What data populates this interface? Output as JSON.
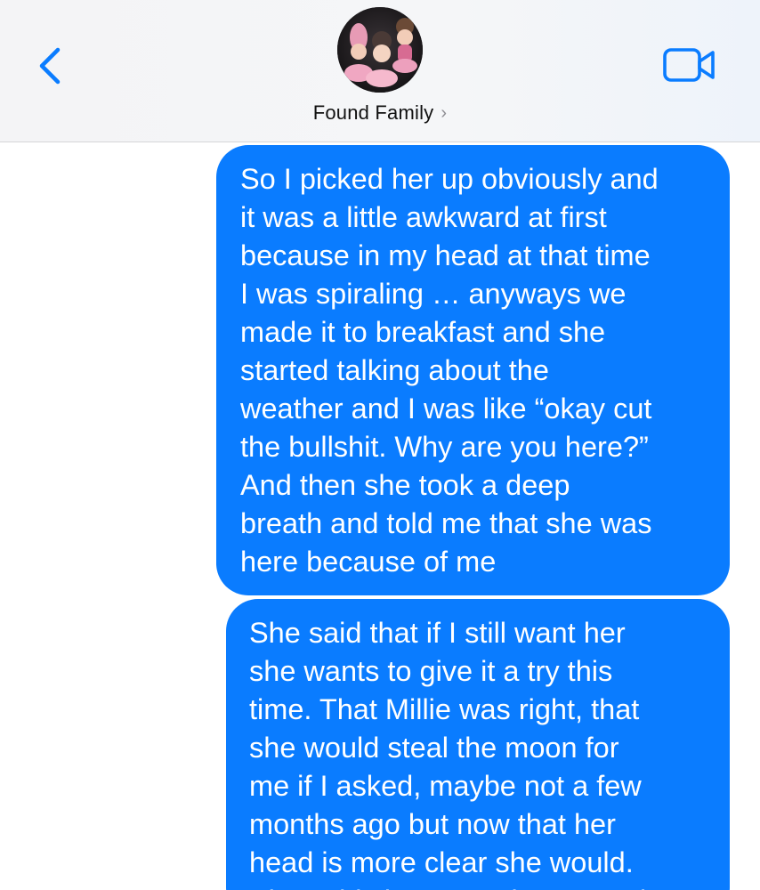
{
  "header": {
    "contact_name": "Found Family",
    "back_icon": "chevron-left-icon",
    "video_icon": "video-camera-icon",
    "disclosure_icon": "chevron-right-icon",
    "accent_color": "#0a7cff"
  },
  "messages": [
    {
      "direction": "outgoing",
      "lines": [
        "So I picked her up obviously and",
        "it was a little awkward at first",
        "because in my head at that time",
        "I was spiraling … anyways we",
        "made it to breakfast and she",
        "started talking about the",
        "weather and I was like “okay cut",
        "the bullshit. Why are you here?”",
        "And then she took a deep",
        "breath and told me that she was",
        "here because of me"
      ]
    },
    {
      "direction": "outgoing",
      "lines": [
        "She said that if I still want her",
        "she wants to give it a try this",
        "time. That Millie was right, that",
        "she would steal the moon for",
        "me if I asked, maybe not a few",
        "months ago but now that her",
        "head is more clear she would.",
        "She said she wanted to try and"
      ]
    }
  ]
}
